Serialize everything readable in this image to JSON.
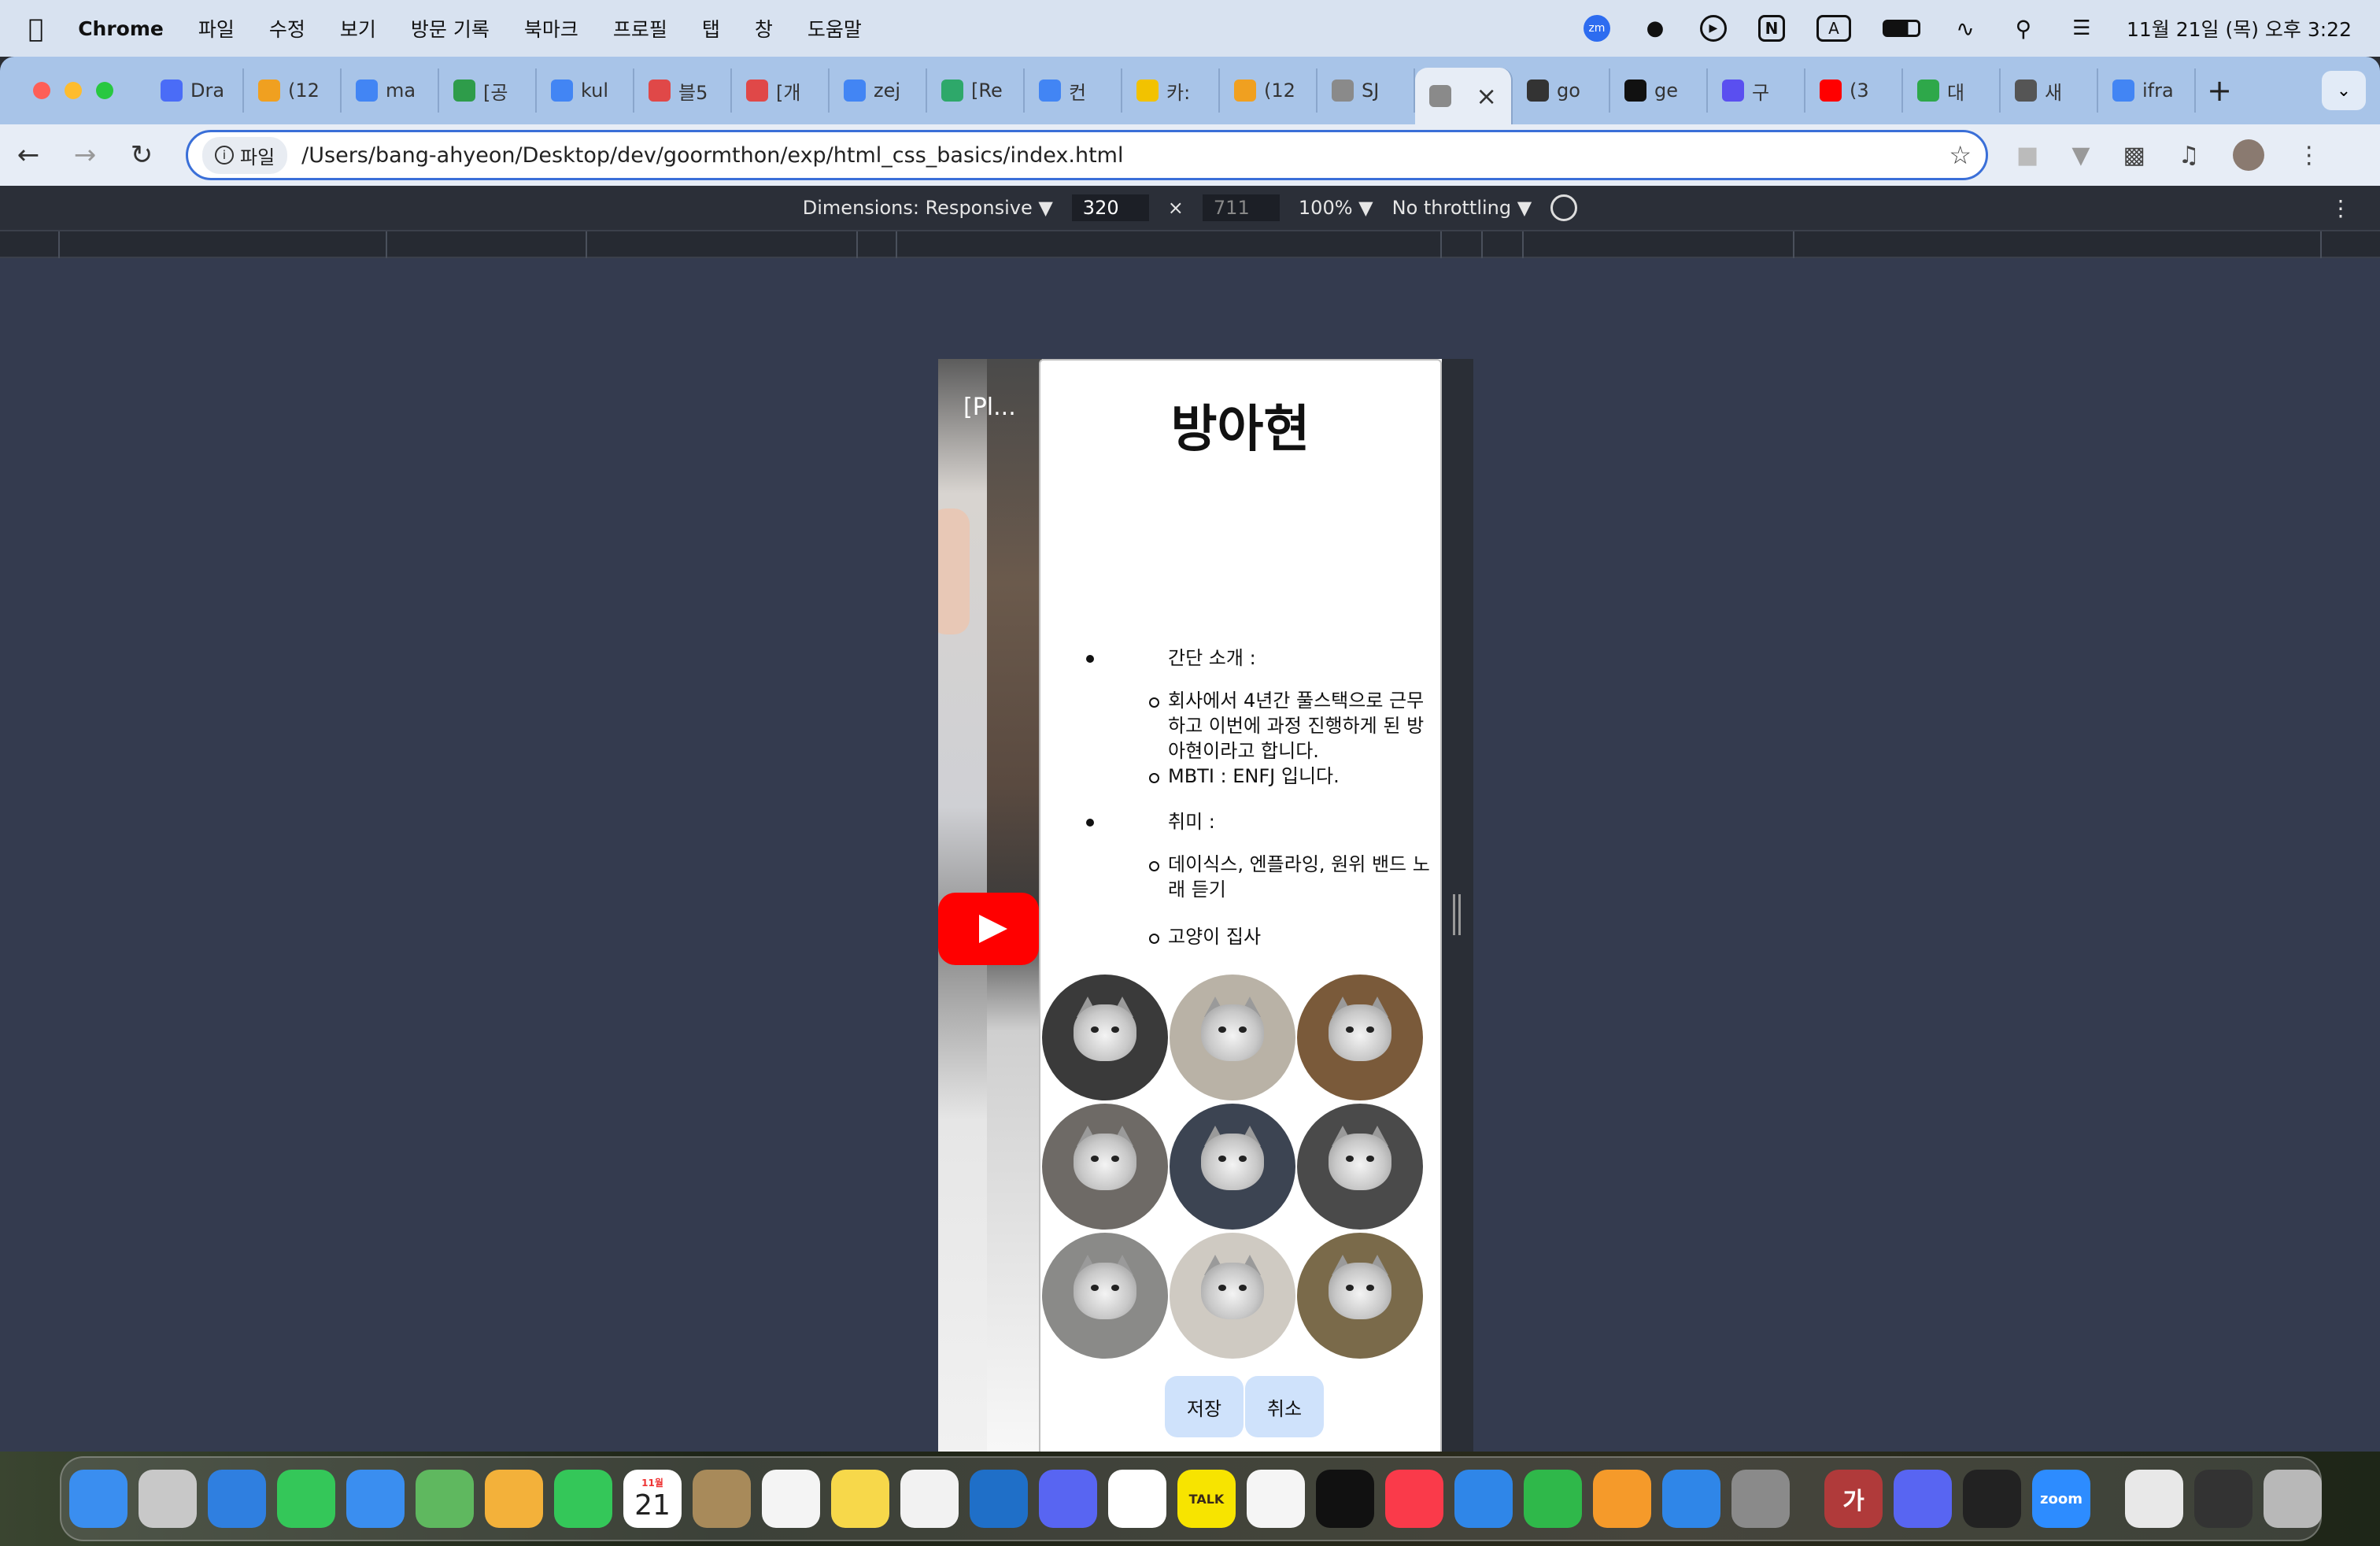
{
  "menubar": {
    "app_name": "Chrome",
    "items": [
      "파일",
      "수정",
      "보기",
      "방문 기록",
      "북마크",
      "프로필",
      "탭",
      "창",
      "도움말"
    ],
    "clock": "11월 21일 (목) 오후 3:22"
  },
  "tabs": [
    {
      "label": "Dra",
      "icon": "drive-icon",
      "color": "#4a6cf7"
    },
    {
      "label": "(12",
      "icon": "emoji-icon",
      "color": "#f0a020"
    },
    {
      "label": "ma",
      "icon": "google-icon",
      "color": "#4285f4"
    },
    {
      "label": "[공",
      "icon": "plus-icon",
      "color": "#2e9c4a"
    },
    {
      "label": "kul",
      "icon": "google-icon",
      "color": "#4285f4"
    },
    {
      "label": "블5",
      "icon": "velog-icon",
      "color": "#e04848"
    },
    {
      "label": "[개",
      "icon": "velog-icon",
      "color": "#e04848"
    },
    {
      "label": "zej",
      "icon": "google-icon",
      "color": "#4285f4"
    },
    {
      "label": "[Re",
      "icon": "vue-icon",
      "color": "#2ea86a"
    },
    {
      "label": "컨",
      "icon": "google-icon",
      "color": "#4285f4"
    },
    {
      "label": "카:",
      "icon": "kakao-icon",
      "color": "#f2c200"
    },
    {
      "label": "(12",
      "icon": "emoji-icon",
      "color": "#f0a020"
    },
    {
      "label": "SJ",
      "icon": "globe-icon",
      "color": "#8a8a8a"
    },
    {
      "label": "",
      "icon": "globe-icon",
      "color": "#8a8a8a",
      "active": true
    },
    {
      "label": "go",
      "icon": "monitor-icon",
      "color": "#333333"
    },
    {
      "label": "ge",
      "icon": "openai-icon",
      "color": "#111111"
    },
    {
      "label": "구",
      "icon": "zep-icon",
      "color": "#5a4ff0"
    },
    {
      "label": "(3",
      "icon": "youtube-icon",
      "color": "#ff0000"
    },
    {
      "label": "대",
      "icon": "chat-icon",
      "color": "#2ea84a"
    },
    {
      "label": "새",
      "icon": "chrome-icon",
      "color": "#555555"
    },
    {
      "label": "ifra",
      "icon": "google-icon",
      "color": "#4285f4"
    }
  ],
  "toolbar": {
    "chip_label": "파일",
    "url": "/Users/bang-ahyeon/Desktop/dev/goormthon/exp/html_css_basics/index.html"
  },
  "devtools": {
    "dimensions_label": "Dimensions: Responsive ▼",
    "width": "320",
    "times": "×",
    "height": "711",
    "zoom": "100% ▼",
    "throttling": "No throttling ▼"
  },
  "page": {
    "video_title": "[Pl...",
    "name": "방아현",
    "intro_label": "간단 소개 :",
    "intro_items": [
      "회사에서 4년간 풀스택으로 근무하고 이번에 과정 진행하게 된 방아현이라고 합니다.",
      "MBTI : ENFJ 입니다."
    ],
    "hobby_label": "취미 :",
    "hobby_items": [
      "데이식스, 엔플라잉, 원위 밴드 노래 듣기",
      "고양이 집사"
    ],
    "cat_backgrounds": [
      "#3a3a3a",
      "#b9b2a6",
      "#7a5a3a",
      "#6e6a66",
      "#3c4452",
      "#4a4a4a",
      "#8a8a88",
      "#cfcac2",
      "#7a6a4a"
    ],
    "save_label": "저장",
    "cancel_label": "취소"
  },
  "dock": {
    "calendar_month": "11월",
    "calendar_day": "21",
    "apps": [
      {
        "name": "finder-icon",
        "color": "#3a8ef0"
      },
      {
        "name": "launchpad-icon",
        "color": "#c8c8c8"
      },
      {
        "name": "safari-icon",
        "color": "#2f7fe0"
      },
      {
        "name": "messages-icon",
        "color": "#34c759"
      },
      {
        "name": "mail-icon",
        "color": "#3a8ef0"
      },
      {
        "name": "maps-icon",
        "color": "#5fb85f"
      },
      {
        "name": "photos-icon",
        "color": "#f3b13a"
      },
      {
        "name": "facetime-icon",
        "color": "#34c759"
      },
      {
        "name": "calendar-icon",
        "color": "#ffffff"
      },
      {
        "name": "contacts-icon",
        "color": "#a88a5a"
      },
      {
        "name": "reminders-icon",
        "color": "#f4f4f4"
      },
      {
        "name": "notes-icon",
        "color": "#f7d84a"
      },
      {
        "name": "chrome-icon",
        "color": "#f2f2f2"
      },
      {
        "name": "vscode-icon",
        "color": "#1f6fc8"
      },
      {
        "name": "discord-icon",
        "color": "#5865f2"
      },
      {
        "name": "notion-icon",
        "color": "#ffffff"
      },
      {
        "name": "kakaotalk-icon",
        "color": "#f7e400"
      },
      {
        "name": "freeform-icon",
        "color": "#f5f5f5"
      },
      {
        "name": "appletv-icon",
        "color": "#111111"
      },
      {
        "name": "music-icon",
        "color": "#fa3a4a"
      },
      {
        "name": "keynote-icon",
        "color": "#2f86e8"
      },
      {
        "name": "numbers-icon",
        "color": "#2fb84a"
      },
      {
        "name": "pages-icon",
        "color": "#f59a2a"
      },
      {
        "name": "appstore-icon",
        "color": "#2f86e8"
      },
      {
        "name": "settings-icon",
        "color": "#8a8a8a"
      },
      {
        "name": "dictionary-icon",
        "color": "#b03a3a"
      },
      {
        "name": "discord-icon",
        "color": "#5865f2"
      },
      {
        "name": "terminal-icon",
        "color": "#222222"
      },
      {
        "name": "zoom-icon",
        "color": "#2d8cff"
      },
      {
        "name": "document-icon",
        "color": "#e8e8e8"
      },
      {
        "name": "screen-icon",
        "color": "#333333"
      },
      {
        "name": "trash-icon",
        "color": "#b8b8b8"
      }
    ],
    "dictionary_label": "가",
    "zoom_label": "zoom",
    "talk_label": "TALK"
  }
}
